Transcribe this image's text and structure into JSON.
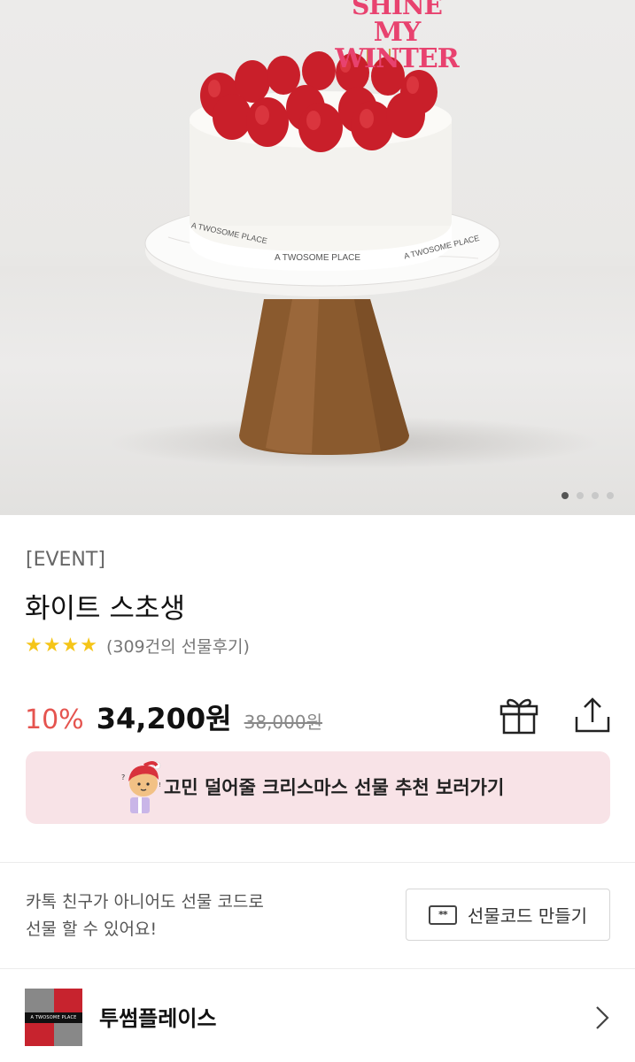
{
  "hero": {
    "topper_line1": "SHINE",
    "topper_line2": "MY WINTER",
    "stand_text_left": "A TWOSOME PLACE",
    "stand_text_center": "A TWOSOME PLACE",
    "stand_text_right": "A TWOSOME PLACE",
    "carousel_total": 4,
    "carousel_active": 1
  },
  "product": {
    "tag": "[EVENT]",
    "name": "화이트 스초생",
    "rating_stars": 4,
    "review_count": "(309건의 선물후기)",
    "discount": "10%",
    "price": "34,200원",
    "original_price": "38,000원"
  },
  "banner": {
    "text": "고민 덜어줄 크리스마스 선물 추천 보러가기"
  },
  "gift_code": {
    "desc_line1": "카톡 친구가 아니어도 선물 코드로",
    "desc_line2": "선물 할 수 있어요!",
    "icon_text": "**",
    "button_label": "선물코드 만들기"
  },
  "brand": {
    "logo_text": "A TWOSOME PLACE",
    "name": "투썸플레이스"
  },
  "colors": {
    "discount": "#e5544f",
    "star": "#f5c518",
    "banner_bg": "#f8e3e7",
    "topper": "#e8426f",
    "brand_red": "#c7232e"
  }
}
